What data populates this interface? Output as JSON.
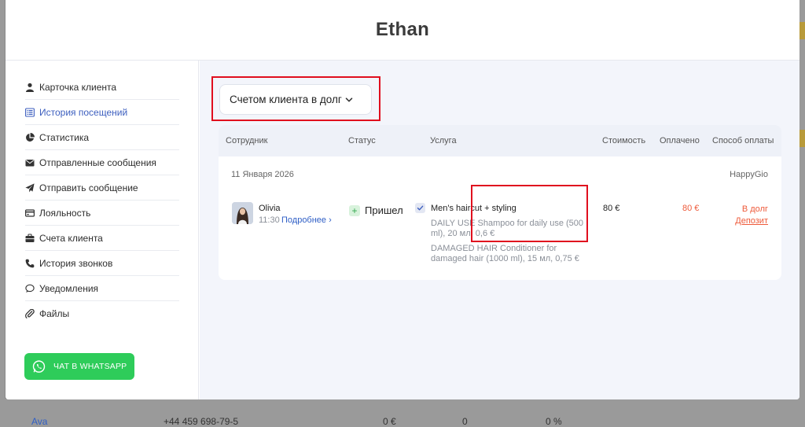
{
  "modal": {
    "title": "Ethan"
  },
  "sidebar": {
    "items": [
      {
        "label": "Карточка клиента",
        "icon": "user-icon",
        "active": false
      },
      {
        "label": "История посещений",
        "icon": "list-icon",
        "active": true
      },
      {
        "label": "Статистика",
        "icon": "pie-chart-icon",
        "active": false
      },
      {
        "label": "Отправленные сообщения",
        "icon": "envelope-icon",
        "active": false
      },
      {
        "label": "Отправить сообщение",
        "icon": "paper-plane-icon",
        "active": false
      },
      {
        "label": "Лояльность",
        "icon": "card-icon",
        "active": false
      },
      {
        "label": "Счета клиента",
        "icon": "briefcase-icon",
        "active": false
      },
      {
        "label": "История звонков",
        "icon": "phone-icon",
        "active": false
      },
      {
        "label": "Уведомления",
        "icon": "chat-bubble-icon",
        "active": false
      },
      {
        "label": "Файлы",
        "icon": "paperclip-icon",
        "active": false
      }
    ],
    "whatsapp_label": "ЧАТ В WHATSAPP"
  },
  "filter": {
    "selected": "Счетом клиента в долг"
  },
  "table": {
    "headers": [
      "Сотрудник",
      "Статус",
      "Услуга",
      "Стоимость",
      "Оплачено",
      "Способ оплаты"
    ],
    "group": {
      "date": "11 Января 2026",
      "salon": "HappyGio"
    },
    "row": {
      "employee": "Olivia",
      "time": "11:30",
      "more": "Подробнее ›",
      "status": "Пришел",
      "service": "Men's haircut + styling",
      "products": [
        "DAILY USE Shampoo for daily use (500 ml), 20 мл, 0,6 €",
        "DAMAGED HAIR Conditioner for damaged hair (1000 ml), 15 мл, 0,75 €"
      ],
      "cost": "80 €",
      "paid": "80 €",
      "payment_method": "В долг",
      "deposit": "Депозит"
    }
  },
  "background": {
    "row": {
      "name": "Ava",
      "phone": "+44 459 698-79-5",
      "v1": "0 €",
      "v2": "0",
      "v3": "0 %"
    }
  },
  "colors": {
    "accent": "#3d5fbf",
    "whatsapp": "#2ecc5a",
    "debt": "#ee5a3a",
    "highlight": "#e00e1e"
  }
}
